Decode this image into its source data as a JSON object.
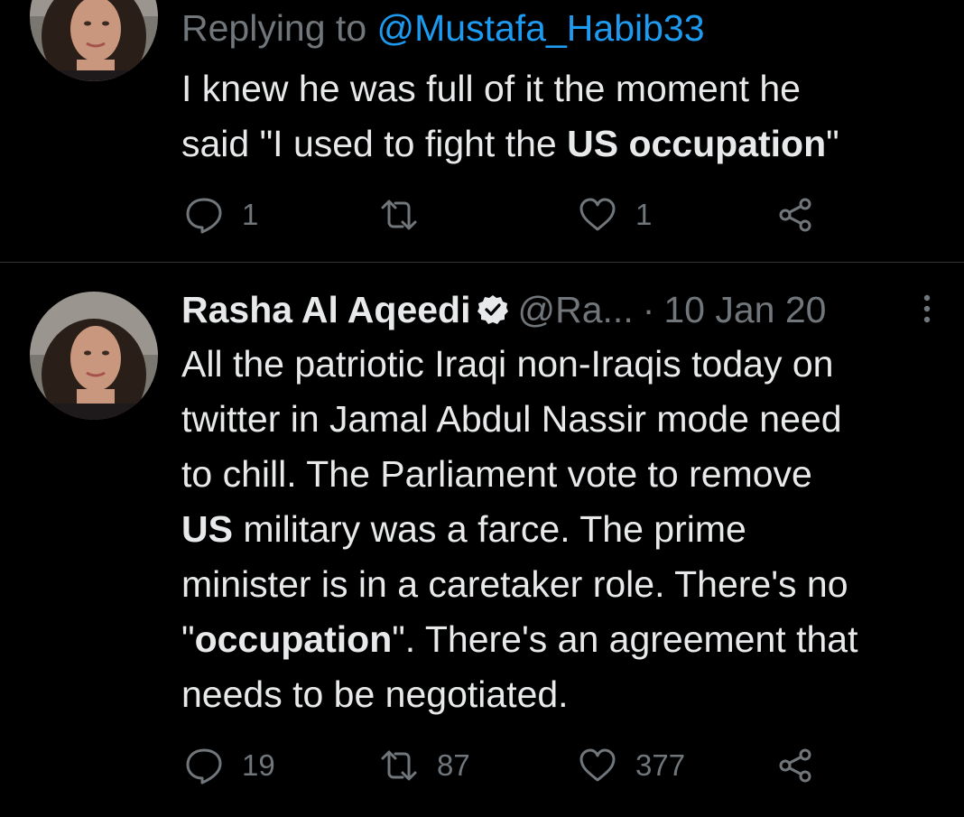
{
  "tweets": [
    {
      "replying_prefix": "Replying to ",
      "replying_handle": "@Mustafa_Habib33",
      "text_lines": [
        [
          {
            "t": "I knew he was full of it the moment he",
            "b": false
          }
        ],
        [
          {
            "t": "said \"I used to fight the ",
            "b": false
          },
          {
            "t": "US occupation",
            "b": true
          },
          {
            "t": "\"",
            "b": false
          }
        ]
      ],
      "actions": {
        "reply_count": "1",
        "retweet_count": "",
        "like_count": "1"
      }
    },
    {
      "display_name": "Rasha Al Aqeedi",
      "handle": "@Ra...",
      "separator": "·",
      "timestamp": "10 Jan 20",
      "text_lines": [
        [
          {
            "t": "All the patriotic Iraqi non-Iraqis today on",
            "b": false
          }
        ],
        [
          {
            "t": "twitter in Jamal Abdul Nassir mode need",
            "b": false
          }
        ],
        [
          {
            "t": "to chill. The Parliament vote to remove",
            "b": false
          }
        ],
        [
          {
            "t": "US",
            "b": true
          },
          {
            "t": " military was a farce. The prime",
            "b": false
          }
        ],
        [
          {
            "t": "minister is in a caretaker role. There's no",
            "b": false
          }
        ],
        [
          {
            "t": "\"",
            "b": false
          },
          {
            "t": "occupation",
            "b": true
          },
          {
            "t": "\". There's an agreement that",
            "b": false
          }
        ],
        [
          {
            "t": "needs to be negotiated.",
            "b": false
          }
        ]
      ],
      "actions": {
        "reply_count": "19",
        "retweet_count": "87",
        "like_count": "377"
      }
    }
  ],
  "icons": {
    "reply": "reply-bubble-icon",
    "retweet": "retweet-icon",
    "like": "heart-icon",
    "share": "share-icon",
    "verified": "verified-badge-icon",
    "more": "more-vertical-icon"
  },
  "colors": {
    "background": "#000000",
    "text": "#e7e9ea",
    "muted": "#71767b",
    "link": "#1d9bf0",
    "divider": "#2f3336"
  }
}
